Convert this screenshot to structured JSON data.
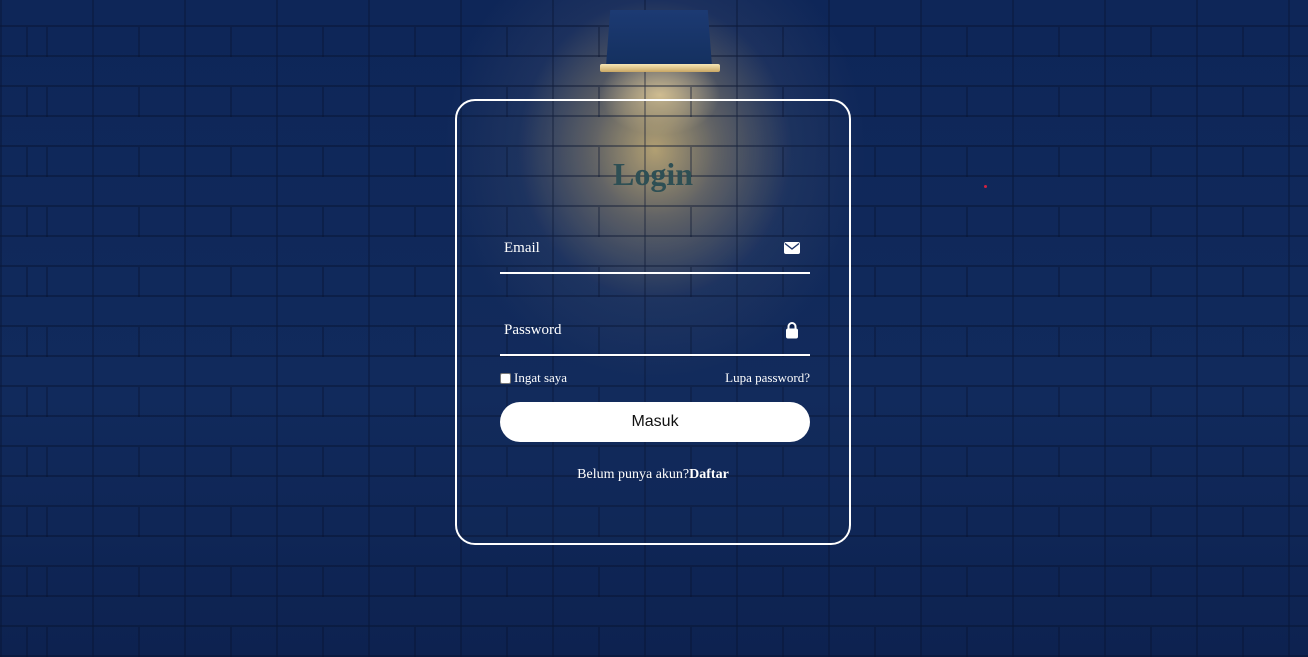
{
  "login": {
    "title": "Login",
    "email": {
      "placeholder": "Email",
      "icon": "mail-icon"
    },
    "password": {
      "placeholder": "Password",
      "icon": "lock-icon"
    },
    "remember_label": "Ingat saya",
    "forgot_label": "Lupa password?",
    "submit_label": "Masuk",
    "register_prompt": "Belum punya akun?",
    "register_link": "Daftar"
  },
  "colors": {
    "title": "#2e4f54",
    "background": "#0f2452",
    "card_border": "#ffffff",
    "button": "#ffffff"
  }
}
